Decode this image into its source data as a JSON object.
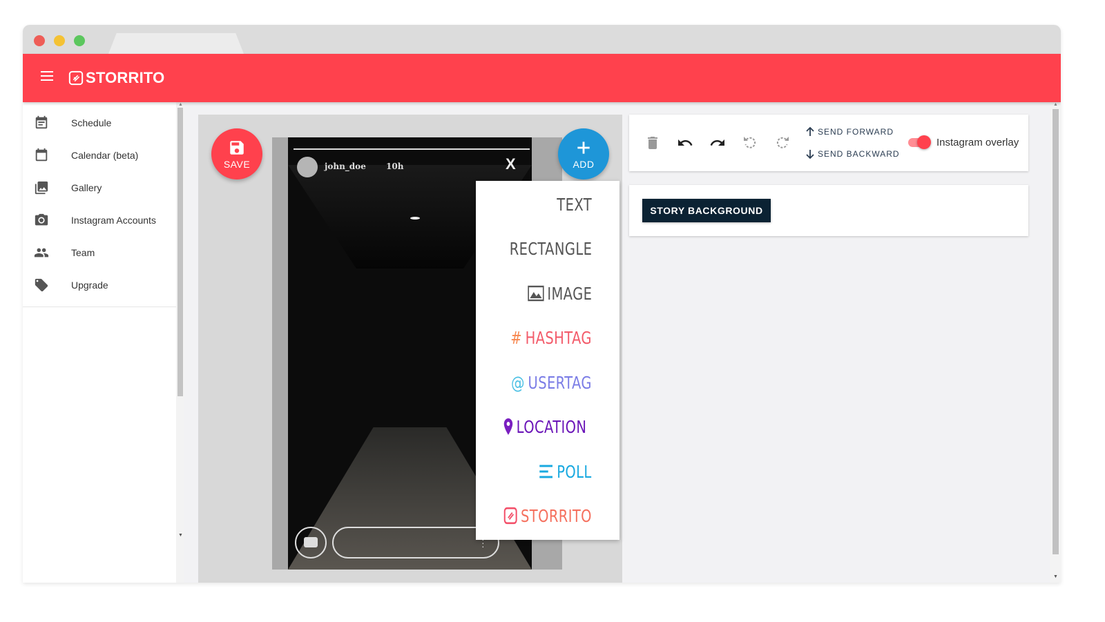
{
  "app": {
    "brand": "STORRITO"
  },
  "sidebar": {
    "items": [
      {
        "label": "Schedule",
        "icon": "event-note-icon"
      },
      {
        "label": "Calendar (beta)",
        "icon": "calendar-icon"
      },
      {
        "label": "Gallery",
        "icon": "gallery-icon"
      },
      {
        "label": "Instagram Accounts",
        "icon": "camera-icon"
      },
      {
        "label": "Team",
        "icon": "people-icon"
      },
      {
        "label": "Upgrade",
        "icon": "tag-icon"
      }
    ]
  },
  "editor": {
    "save_label": "SAVE",
    "add_label": "ADD",
    "story": {
      "username": "john_doe",
      "time": "10h",
      "close": "X"
    },
    "add_menu": [
      {
        "label": "TEXT",
        "color": "#555555",
        "icon": ""
      },
      {
        "label": "RECTANGLE",
        "color": "#555555",
        "icon": ""
      },
      {
        "label": "IMAGE",
        "color": "#555555",
        "icon": "image-icon"
      },
      {
        "label": "HASHTAG",
        "color": "#f35b6a",
        "icon": "hashtag-icon",
        "prefix": "#"
      },
      {
        "label": "USERTAG",
        "color": "#7b7de6",
        "icon": "at-icon",
        "prefix": "@"
      },
      {
        "label": "LOCATION",
        "color": "#6b16b8",
        "icon": "location-pin-icon"
      },
      {
        "label": "POLL",
        "color": "#19a9e0",
        "icon": "poll-icon"
      },
      {
        "label": "STORRITO",
        "color": "#f35b6a",
        "icon": "storrito-icon"
      }
    ]
  },
  "toolbar": {
    "send_forward": "SEND FORWARD",
    "send_backward": "SEND BACKWARD",
    "overlay_label": "Instagram overlay",
    "overlay_on": true
  },
  "background_panel": {
    "button_label": "STORY BACKGROUND"
  },
  "colors": {
    "brand_red": "#ff414d",
    "add_blue": "#1e96d8",
    "dark_navy": "#0b2233"
  }
}
